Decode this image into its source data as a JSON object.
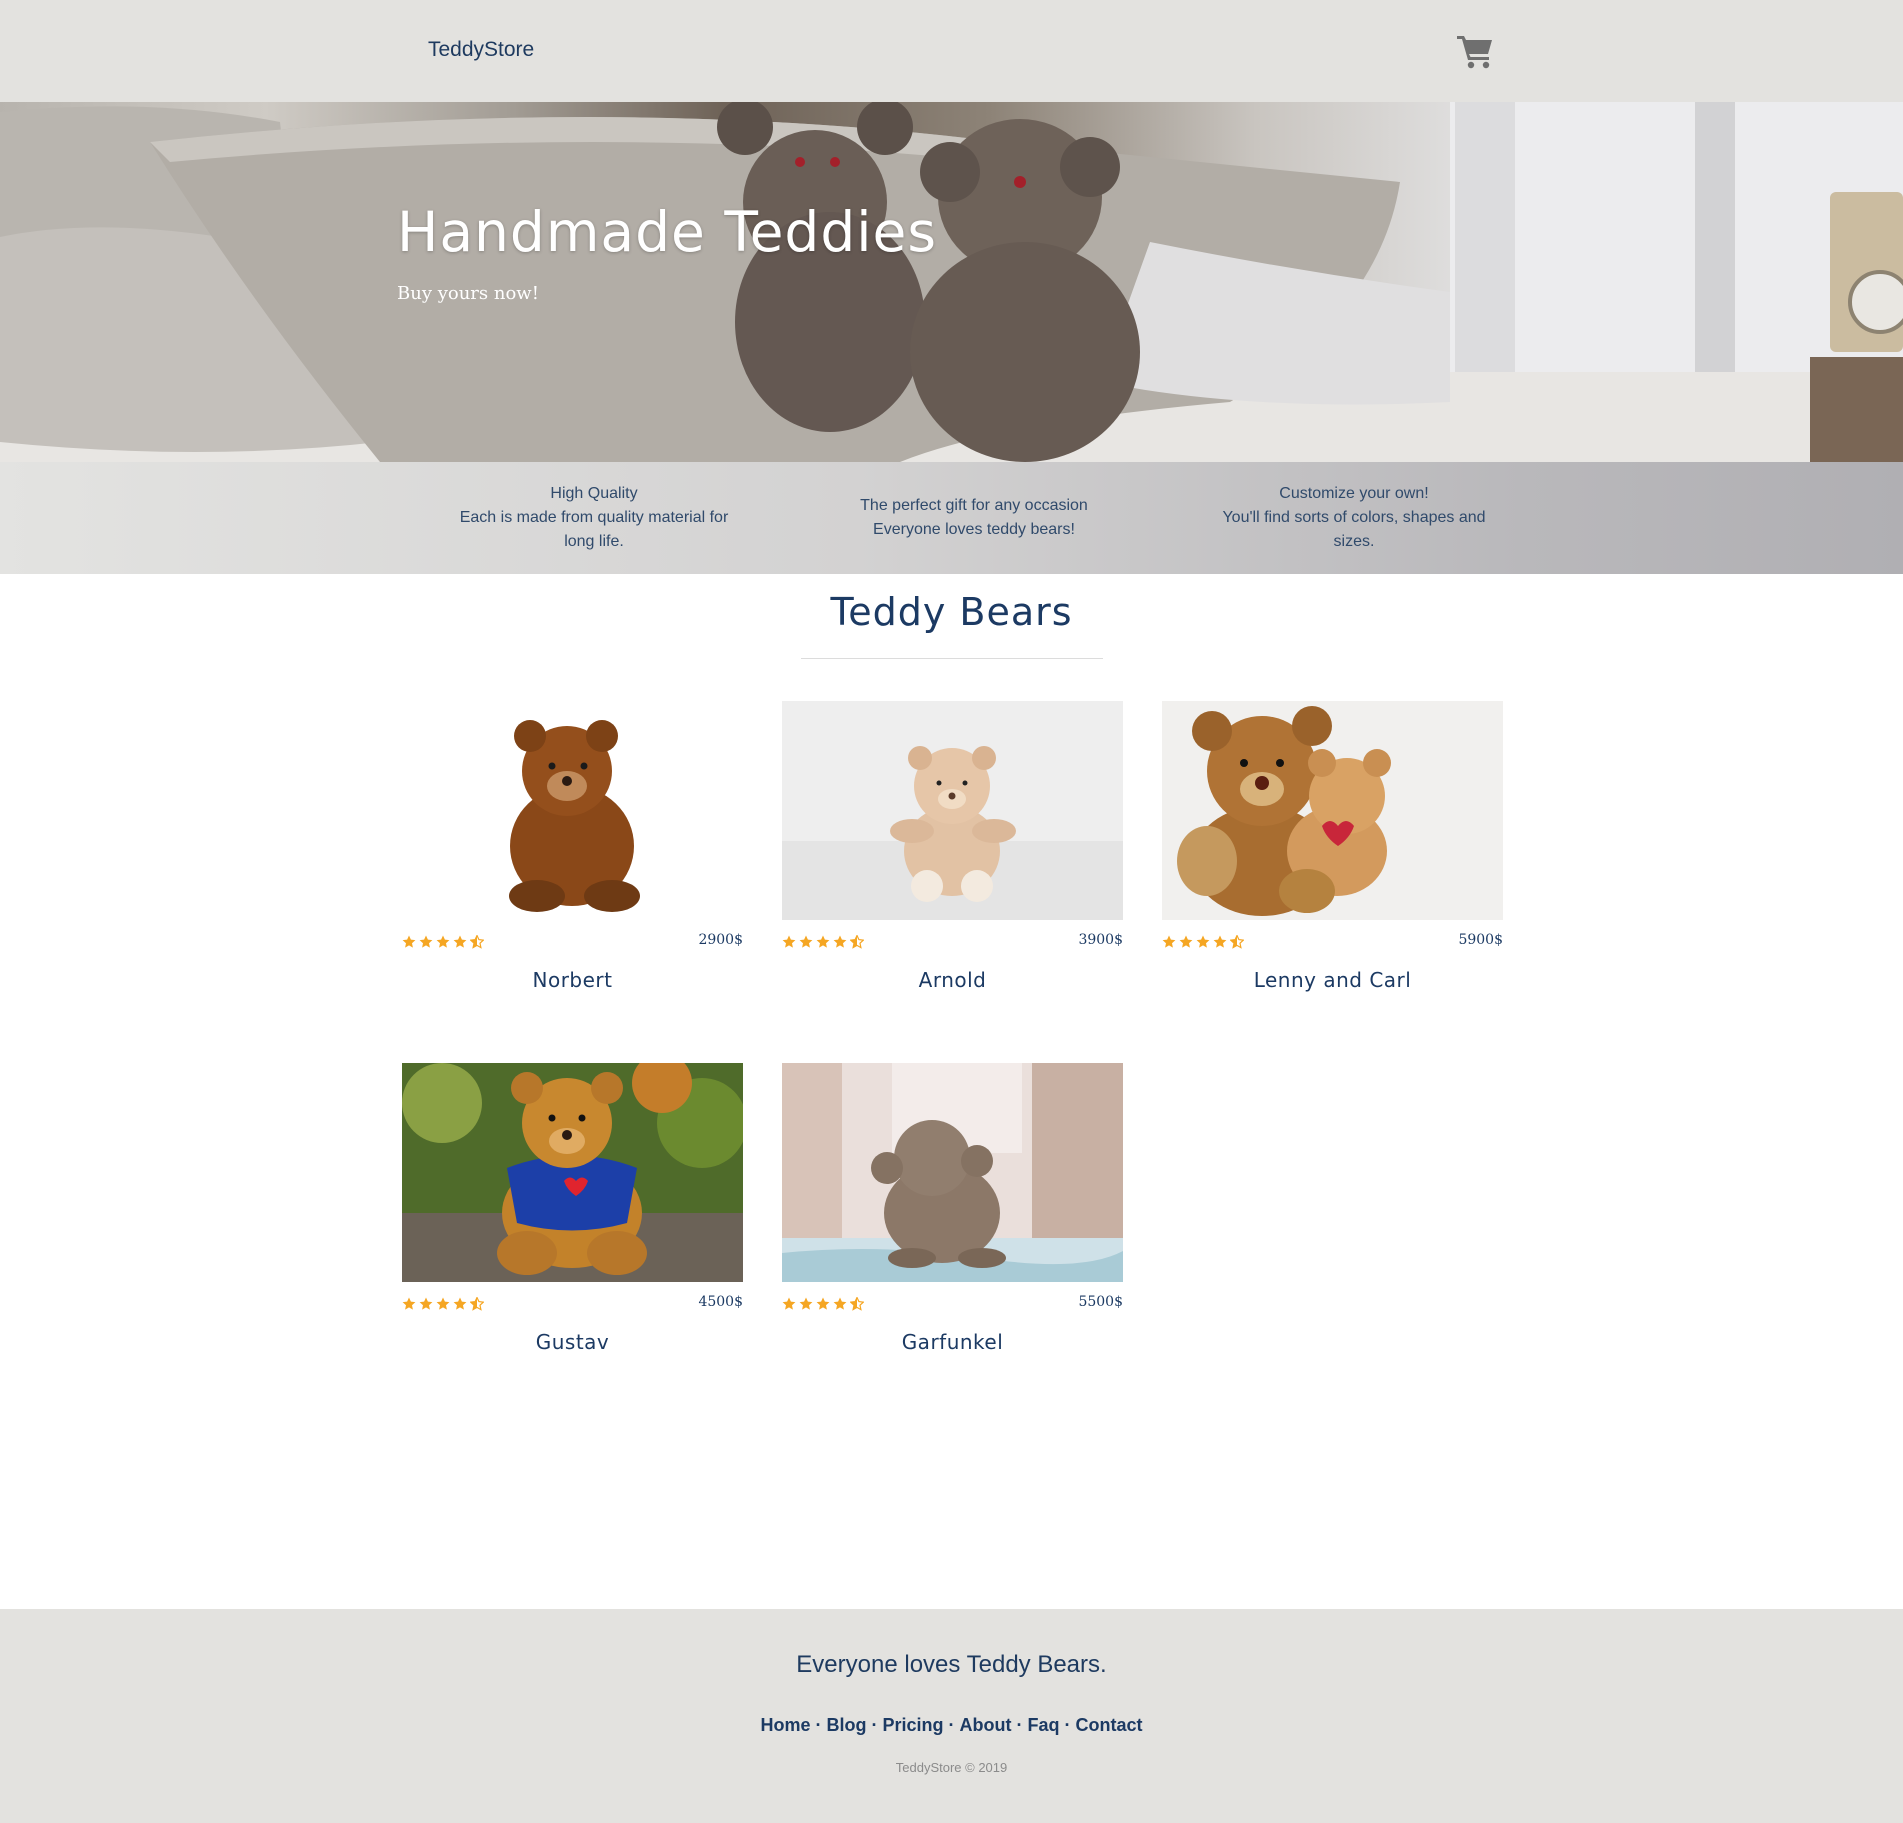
{
  "nav": {
    "brand": "TeddyStore",
    "cart_icon": "shopping-cart-icon"
  },
  "hero": {
    "title": "Handmade Teddies",
    "subtitle": "Buy yours now!"
  },
  "features": [
    {
      "title": "High Quality",
      "text": "Each is made from quality material for long life."
    },
    {
      "title": "The perfect gift for any occasion",
      "text": "Everyone loves teddy bears!"
    },
    {
      "title": "Customize your own!",
      "text": "You'll find sorts of colors, shapes and sizes."
    }
  ],
  "section": {
    "title": "Teddy Bears"
  },
  "products": [
    {
      "name": "Norbert",
      "price": "2900$",
      "rating": 4.5
    },
    {
      "name": "Arnold",
      "price": "3900$",
      "rating": 4.5
    },
    {
      "name": "Lenny and Carl",
      "price": "5900$",
      "rating": 4.5
    },
    {
      "name": "Gustav",
      "price": "4500$",
      "rating": 4.5
    },
    {
      "name": "Garfunkel",
      "price": "5500$",
      "rating": 4.5
    }
  ],
  "footer": {
    "tagline": "Everyone loves Teddy Bears.",
    "links": [
      "Home",
      "Blog",
      "Pricing",
      "About",
      "Faq",
      "Contact"
    ],
    "copyright": "TeddyStore © 2019"
  },
  "colors": {
    "navy": "#1c3a63",
    "nav_bg": "#e3e2df",
    "star": "#f5a623"
  }
}
